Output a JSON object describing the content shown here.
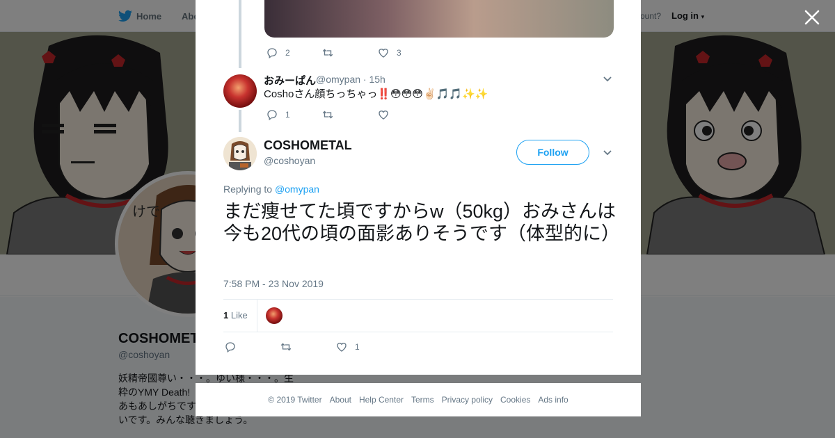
{
  "nav": {
    "home_label": "Home",
    "about_label": "Abo",
    "account_text": "ccount?",
    "login_label": "Log in"
  },
  "profile": {
    "name": "COSHOMET",
    "handle": "@coshoyan",
    "bio_lines": [
      "妖精帝國尊い・・・。ゆい様・・・。生",
      "粋のYMY Death! ",
      "あもあしがちです",
      "いです。みんな聴きましょう。"
    ]
  },
  "thread": {
    "prev_actions": {
      "reply_count": "2",
      "retweet_count": "",
      "like_count": "3"
    },
    "reply": {
      "name": "おみーぱん",
      "handle": "@omypan",
      "time": "· 15h",
      "text": "Coshoさん顔ちっちゃっ‼️😳😳😳✌🏻🎵🎵✨✨",
      "reply_count": "1",
      "retweet_count": "",
      "like_count": ""
    }
  },
  "main_tweet": {
    "name": "COSHOMETAL",
    "handle": "@coshoyan",
    "follow_label": "Follow",
    "replying_prefix": "Replying to",
    "replying_to": "@omypan",
    "text": "まだ痩せてた頃ですからw（50kg）おみさんは今も20代の頃の面影ありそうです（体型的に）",
    "timestamp": "7:58 PM - 23 Nov 2019",
    "likes_count": "1",
    "likes_label": "Like",
    "actions": {
      "reply_count": "",
      "retweet_count": "",
      "like_count": "1"
    }
  },
  "footer": {
    "copyright": "© 2019 Twitter",
    "links": [
      "About",
      "Help Center",
      "Terms",
      "Privacy policy",
      "Cookies",
      "Ads info"
    ]
  },
  "colors": {
    "accent": "#1da1f2",
    "text": "#14171a",
    "muted": "#657786",
    "border": "#e6ecf0"
  }
}
